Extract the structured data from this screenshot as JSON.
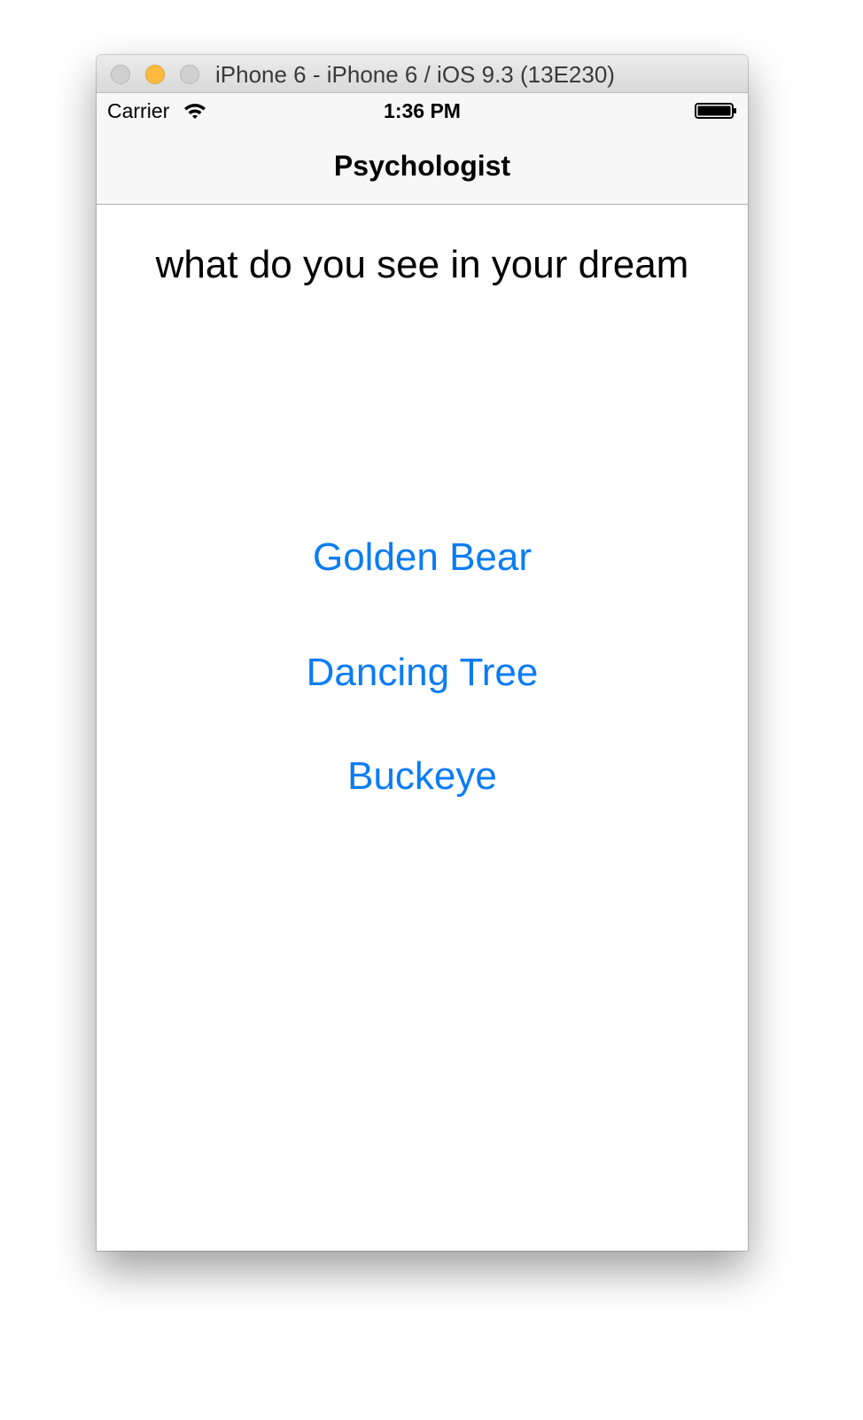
{
  "window": {
    "title": "iPhone 6 - iPhone 6 / iOS 9.3 (13E230)"
  },
  "status_bar": {
    "carrier": "Carrier",
    "time": "1:36 PM",
    "icons": [
      "wifi-icon",
      "battery-icon"
    ]
  },
  "nav_bar": {
    "title": "Psychologist"
  },
  "main": {
    "question": "what do you see in your dream",
    "answers": [
      {
        "label": "Golden Bear"
      },
      {
        "label": "Dancing Tree"
      },
      {
        "label": "Buckeye"
      }
    ]
  },
  "colors": {
    "tint": "#0a7cf4",
    "minimize_button": "#fdbc40",
    "bar_background": "#f7f7f7"
  }
}
